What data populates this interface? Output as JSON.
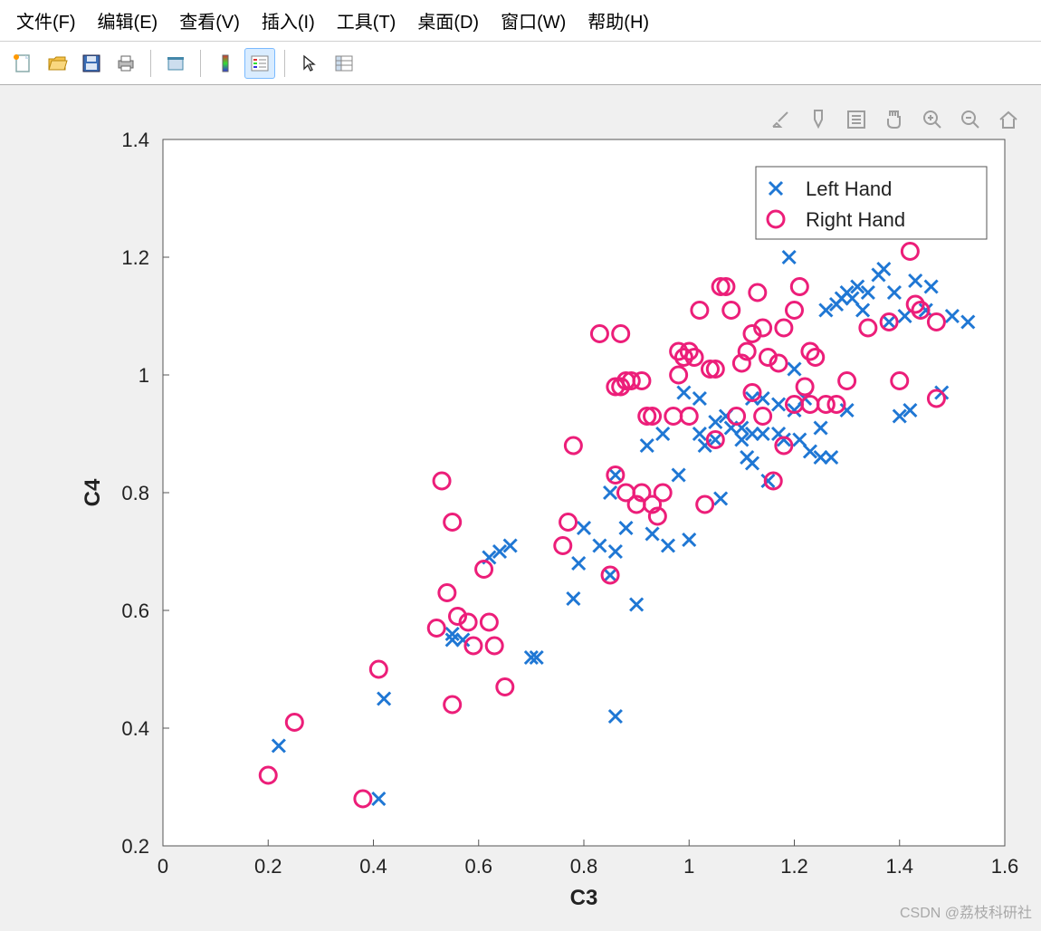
{
  "menu": {
    "items": [
      "文件(F)",
      "编辑(E)",
      "查看(V)",
      "插入(I)",
      "工具(T)",
      "桌面(D)",
      "窗口(W)",
      "帮助(H)"
    ]
  },
  "toolbar_icons": [
    "new-file-icon",
    "open-folder-icon",
    "save-icon",
    "print-icon",
    "print-preview-icon",
    "colorbar-icon",
    "legend-icon",
    "cursor-icon",
    "data-tips-icon"
  ],
  "axes_toolbar_icons": [
    "brush-icon",
    "pencil-icon",
    "notes-icon",
    "pan-icon",
    "zoom-in-icon",
    "zoom-out-icon",
    "home-icon"
  ],
  "chart_data": {
    "type": "scatter",
    "xlabel": "C3",
    "ylabel": "C4",
    "xlim": [
      0,
      1.6
    ],
    "ylim": [
      0.2,
      1.4
    ],
    "xticks": [
      0,
      0.2,
      0.4,
      0.6,
      0.8,
      1.0,
      1.2,
      1.4,
      1.6
    ],
    "yticks": [
      0.2,
      0.4,
      0.6,
      0.8,
      1.0,
      1.2,
      1.4
    ],
    "legend": {
      "position": "northeast",
      "entries": [
        "Left Hand",
        "Right Hand"
      ]
    },
    "series": [
      {
        "name": "Left Hand",
        "marker": "x",
        "color": "#1f77d4",
        "points": [
          [
            0.22,
            0.37
          ],
          [
            0.41,
            0.28
          ],
          [
            0.42,
            0.45
          ],
          [
            0.55,
            0.56
          ],
          [
            0.55,
            0.55
          ],
          [
            0.57,
            0.55
          ],
          [
            0.62,
            0.69
          ],
          [
            0.64,
            0.7
          ],
          [
            0.66,
            0.71
          ],
          [
            0.7,
            0.52
          ],
          [
            0.71,
            0.52
          ],
          [
            0.78,
            0.62
          ],
          [
            0.79,
            0.68
          ],
          [
            0.8,
            0.74
          ],
          [
            0.83,
            0.71
          ],
          [
            0.85,
            0.8
          ],
          [
            0.85,
            0.66
          ],
          [
            0.86,
            0.7
          ],
          [
            0.86,
            0.83
          ],
          [
            0.86,
            0.42
          ],
          [
            0.88,
            0.74
          ],
          [
            0.9,
            0.61
          ],
          [
            0.92,
            0.88
          ],
          [
            0.93,
            0.73
          ],
          [
            0.95,
            0.9
          ],
          [
            0.96,
            0.71
          ],
          [
            0.98,
            0.83
          ],
          [
            0.99,
            0.97
          ],
          [
            1.0,
            0.72
          ],
          [
            1.02,
            0.96
          ],
          [
            1.02,
            0.9
          ],
          [
            1.03,
            0.88
          ],
          [
            1.05,
            0.92
          ],
          [
            1.05,
            0.89
          ],
          [
            1.06,
            0.79
          ],
          [
            1.07,
            0.93
          ],
          [
            1.08,
            0.91
          ],
          [
            1.1,
            0.91
          ],
          [
            1.1,
            0.89
          ],
          [
            1.11,
            0.86
          ],
          [
            1.12,
            0.96
          ],
          [
            1.12,
            0.9
          ],
          [
            1.12,
            0.85
          ],
          [
            1.14,
            0.96
          ],
          [
            1.14,
            0.9
          ],
          [
            1.15,
            0.82
          ],
          [
            1.17,
            0.95
          ],
          [
            1.17,
            0.9
          ],
          [
            1.18,
            0.89
          ],
          [
            1.19,
            1.2
          ],
          [
            1.2,
            1.01
          ],
          [
            1.2,
            0.94
          ],
          [
            1.21,
            0.89
          ],
          [
            1.22,
            0.96
          ],
          [
            1.23,
            0.87
          ],
          [
            1.25,
            0.91
          ],
          [
            1.25,
            0.86
          ],
          [
            1.26,
            1.11
          ],
          [
            1.27,
            0.86
          ],
          [
            1.28,
            1.12
          ],
          [
            1.29,
            1.13
          ],
          [
            1.3,
            1.14
          ],
          [
            1.3,
            0.94
          ],
          [
            1.31,
            1.13
          ],
          [
            1.32,
            1.15
          ],
          [
            1.33,
            1.11
          ],
          [
            1.34,
            1.14
          ],
          [
            1.36,
            1.17
          ],
          [
            1.37,
            1.18
          ],
          [
            1.38,
            1.09
          ],
          [
            1.39,
            1.14
          ],
          [
            1.4,
            0.93
          ],
          [
            1.41,
            1.1
          ],
          [
            1.42,
            0.94
          ],
          [
            1.43,
            1.16
          ],
          [
            1.45,
            1.11
          ],
          [
            1.46,
            1.15
          ],
          [
            1.48,
            0.97
          ],
          [
            1.5,
            1.1
          ],
          [
            1.53,
            1.09
          ]
        ]
      },
      {
        "name": "Right Hand",
        "marker": "o",
        "color": "#ec1e79",
        "points": [
          [
            0.2,
            0.32
          ],
          [
            0.25,
            0.41
          ],
          [
            0.38,
            0.28
          ],
          [
            0.41,
            0.5
          ],
          [
            0.52,
            0.57
          ],
          [
            0.53,
            0.82
          ],
          [
            0.54,
            0.63
          ],
          [
            0.55,
            0.44
          ],
          [
            0.55,
            0.75
          ],
          [
            0.56,
            0.59
          ],
          [
            0.58,
            0.58
          ],
          [
            0.59,
            0.54
          ],
          [
            0.61,
            0.67
          ],
          [
            0.62,
            0.58
          ],
          [
            0.63,
            0.54
          ],
          [
            0.65,
            0.47
          ],
          [
            0.76,
            0.71
          ],
          [
            0.77,
            0.75
          ],
          [
            0.78,
            0.88
          ],
          [
            0.83,
            1.07
          ],
          [
            0.85,
            0.66
          ],
          [
            0.86,
            0.98
          ],
          [
            0.86,
            0.83
          ],
          [
            0.87,
            0.98
          ],
          [
            0.87,
            1.07
          ],
          [
            0.88,
            0.8
          ],
          [
            0.88,
            0.99
          ],
          [
            0.89,
            0.99
          ],
          [
            0.9,
            0.78
          ],
          [
            0.91,
            0.99
          ],
          [
            0.91,
            0.8
          ],
          [
            0.92,
            0.93
          ],
          [
            0.93,
            0.93
          ],
          [
            0.93,
            0.78
          ],
          [
            0.94,
            0.76
          ],
          [
            0.95,
            0.8
          ],
          [
            0.97,
            0.93
          ],
          [
            0.98,
            1.04
          ],
          [
            0.98,
            1.0
          ],
          [
            0.99,
            1.03
          ],
          [
            1.0,
            1.04
          ],
          [
            1.0,
            0.93
          ],
          [
            1.01,
            1.03
          ],
          [
            1.02,
            1.11
          ],
          [
            1.03,
            0.78
          ],
          [
            1.04,
            1.01
          ],
          [
            1.05,
            1.01
          ],
          [
            1.05,
            0.89
          ],
          [
            1.06,
            1.15
          ],
          [
            1.07,
            1.15
          ],
          [
            1.08,
            1.11
          ],
          [
            1.09,
            0.93
          ],
          [
            1.1,
            1.02
          ],
          [
            1.11,
            1.04
          ],
          [
            1.12,
            1.07
          ],
          [
            1.12,
            0.97
          ],
          [
            1.13,
            1.14
          ],
          [
            1.14,
            1.08
          ],
          [
            1.14,
            0.93
          ],
          [
            1.15,
            1.03
          ],
          [
            1.16,
            0.82
          ],
          [
            1.17,
            1.02
          ],
          [
            1.18,
            1.08
          ],
          [
            1.18,
            0.88
          ],
          [
            1.2,
            1.11
          ],
          [
            1.2,
            0.95
          ],
          [
            1.21,
            1.15
          ],
          [
            1.22,
            0.98
          ],
          [
            1.23,
            1.04
          ],
          [
            1.23,
            0.95
          ],
          [
            1.24,
            1.03
          ],
          [
            1.26,
            0.95
          ],
          [
            1.28,
            0.95
          ],
          [
            1.3,
            0.99
          ],
          [
            1.34,
            1.08
          ],
          [
            1.38,
            1.09
          ],
          [
            1.4,
            0.99
          ],
          [
            1.42,
            1.21
          ],
          [
            1.43,
            1.12
          ],
          [
            1.44,
            1.11
          ],
          [
            1.47,
            1.09
          ],
          [
            1.47,
            0.96
          ]
        ]
      }
    ]
  },
  "watermark": "CSDN @荔枝科研社"
}
